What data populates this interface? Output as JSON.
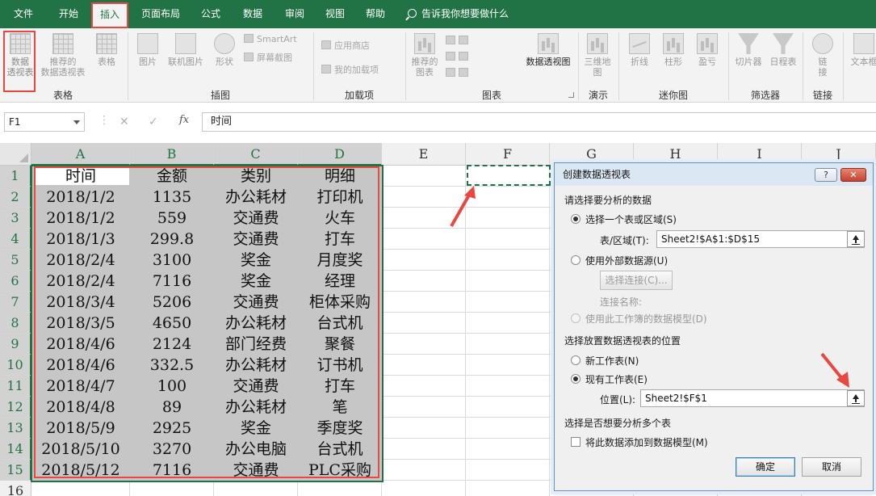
{
  "tabs": [
    "文件",
    "开始",
    "插入",
    "页面布局",
    "公式",
    "数据",
    "审阅",
    "视图",
    "帮助"
  ],
  "active_tab": "插入",
  "tell_me": "告诉我你想要做什么",
  "ribbon": {
    "pivot_table": "数据\n透视表",
    "recommended_pivot": "推荐的\n数据透视表",
    "table": "表格",
    "picture": "图片",
    "online_picture": "联机图片",
    "shapes": "形状",
    "smartart": "SmartArt",
    "screenshot": "屏幕截图",
    "app_store": "应用商店",
    "my_addins": "我的加载项",
    "recommended_charts": "推荐的\n图表",
    "pivot_chart": "数据透视图",
    "map_3d": "三维地\n图",
    "line": "折线",
    "column": "柱形",
    "win_loss": "盈亏",
    "slicer": "切片器",
    "timeline": "日程表",
    "link": "链\n接",
    "textbox": "文本框",
    "groups": {
      "tables": "表格",
      "illustrations": "插图",
      "addins": "加载项",
      "charts": "图表",
      "tours": "演示",
      "sparklines": "迷你图",
      "filters": "筛选器",
      "links": "链接"
    }
  },
  "formula_bar": {
    "name_box": "F1",
    "cancel_icon": "✕",
    "enter_icon": "✓",
    "fx": "fx",
    "content": "时间"
  },
  "columns": [
    "A",
    "B",
    "C",
    "D",
    "E",
    "F",
    "G",
    "H",
    "I",
    "J"
  ],
  "rows": [
    "1",
    "2",
    "3",
    "4",
    "5",
    "6",
    "7",
    "8",
    "9",
    "10",
    "11",
    "12",
    "13",
    "14",
    "15",
    "16"
  ],
  "table": [
    [
      "时间",
      "金额",
      "类别",
      "明细"
    ],
    [
      "2018/1/2",
      "1135",
      "办公耗材",
      "打印机"
    ],
    [
      "2018/1/2",
      "559",
      "交通费",
      "火车"
    ],
    [
      "2018/1/3",
      "299.8",
      "交通费",
      "打车"
    ],
    [
      "2018/2/4",
      "3100",
      "奖金",
      "月度奖"
    ],
    [
      "2018/2/4",
      "7116",
      "奖金",
      "经理"
    ],
    [
      "2018/3/4",
      "5206",
      "交通费",
      "柜体采购"
    ],
    [
      "2018/3/5",
      "4650",
      "办公耗材",
      "台式机"
    ],
    [
      "2018/4/6",
      "2124",
      "部门经费",
      "聚餐"
    ],
    [
      "2018/4/6",
      "332.5",
      "办公耗材",
      "订书机"
    ],
    [
      "2018/4/7",
      "100",
      "交通费",
      "打车"
    ],
    [
      "2018/4/8",
      "89",
      "办公耗材",
      "笔"
    ],
    [
      "2018/5/9",
      "2925",
      "奖金",
      "季度奖"
    ],
    [
      "2018/5/10",
      "3270",
      "办公电脑",
      "台式机"
    ],
    [
      "2018/5/12",
      "7116",
      "交通费",
      "PLC采购"
    ]
  ],
  "dialog": {
    "title": "创建数据透视表",
    "help": "?",
    "close": "✕",
    "section_data": "请选择要分析的数据",
    "opt_range": "选择一个表或区域(S)",
    "range_label": "表/区域(T):",
    "range_value": "Sheet2!$A$1:$D$15",
    "opt_external": "使用外部数据源(U)",
    "choose_conn": "选择连接(C)...",
    "conn_name": "连接名称:",
    "opt_datamodel": "使用此工作簿的数据模型(D)",
    "section_location": "选择放置数据透视表的位置",
    "opt_new": "新工作表(N)",
    "opt_existing": "现有工作表(E)",
    "location_label": "位置(L):",
    "location_value": "Sheet2!$F$1",
    "section_multi": "选择是否想要分析多个表",
    "add_model": "将此数据添加到数据模型(M)",
    "ok": "确定",
    "cancel": "取消"
  },
  "colors": {
    "ribbon_green": "#217346",
    "highlight_red": "#e8483f",
    "selection_gray": "#c6c6c6"
  }
}
